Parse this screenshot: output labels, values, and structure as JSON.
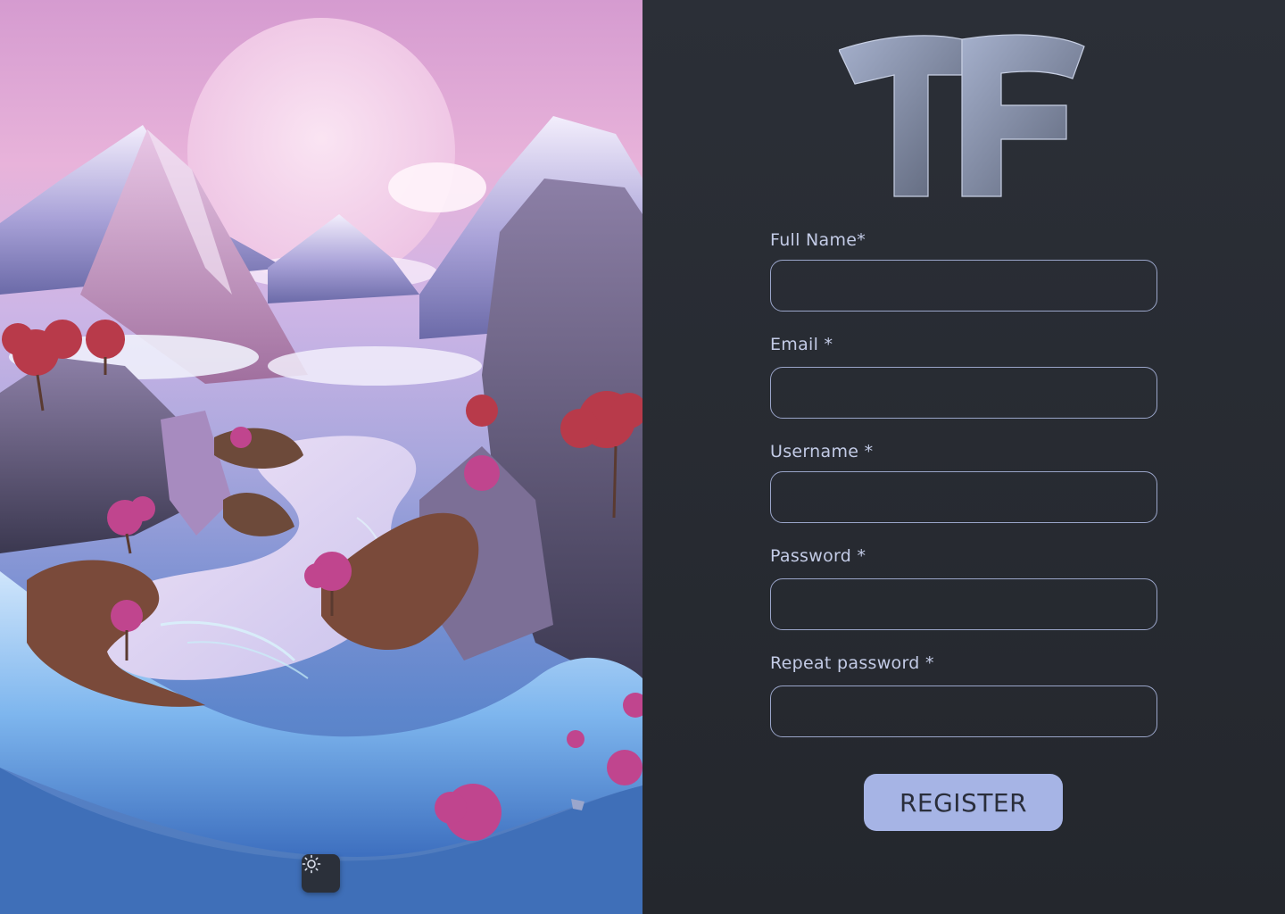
{
  "theme_toggle": {
    "icon": "sun-icon"
  },
  "form": {
    "fields": [
      {
        "label": "Full Name*",
        "value": "",
        "placeholder": ""
      },
      {
        "label": "Email *",
        "value": "",
        "placeholder": ""
      },
      {
        "label": "Username *",
        "value": "",
        "placeholder": ""
      },
      {
        "label": "Password *",
        "value": "",
        "placeholder": ""
      },
      {
        "label": "Repeat password *",
        "value": "",
        "placeholder": ""
      }
    ],
    "submit_label": "REGISTER"
  },
  "colors": {
    "panel_bg": "#2a2e36",
    "label": "#c3cbe6",
    "input_border": "#9aa5c9",
    "button_bg": "#a6b4e5",
    "button_text": "#2a2e3b"
  }
}
